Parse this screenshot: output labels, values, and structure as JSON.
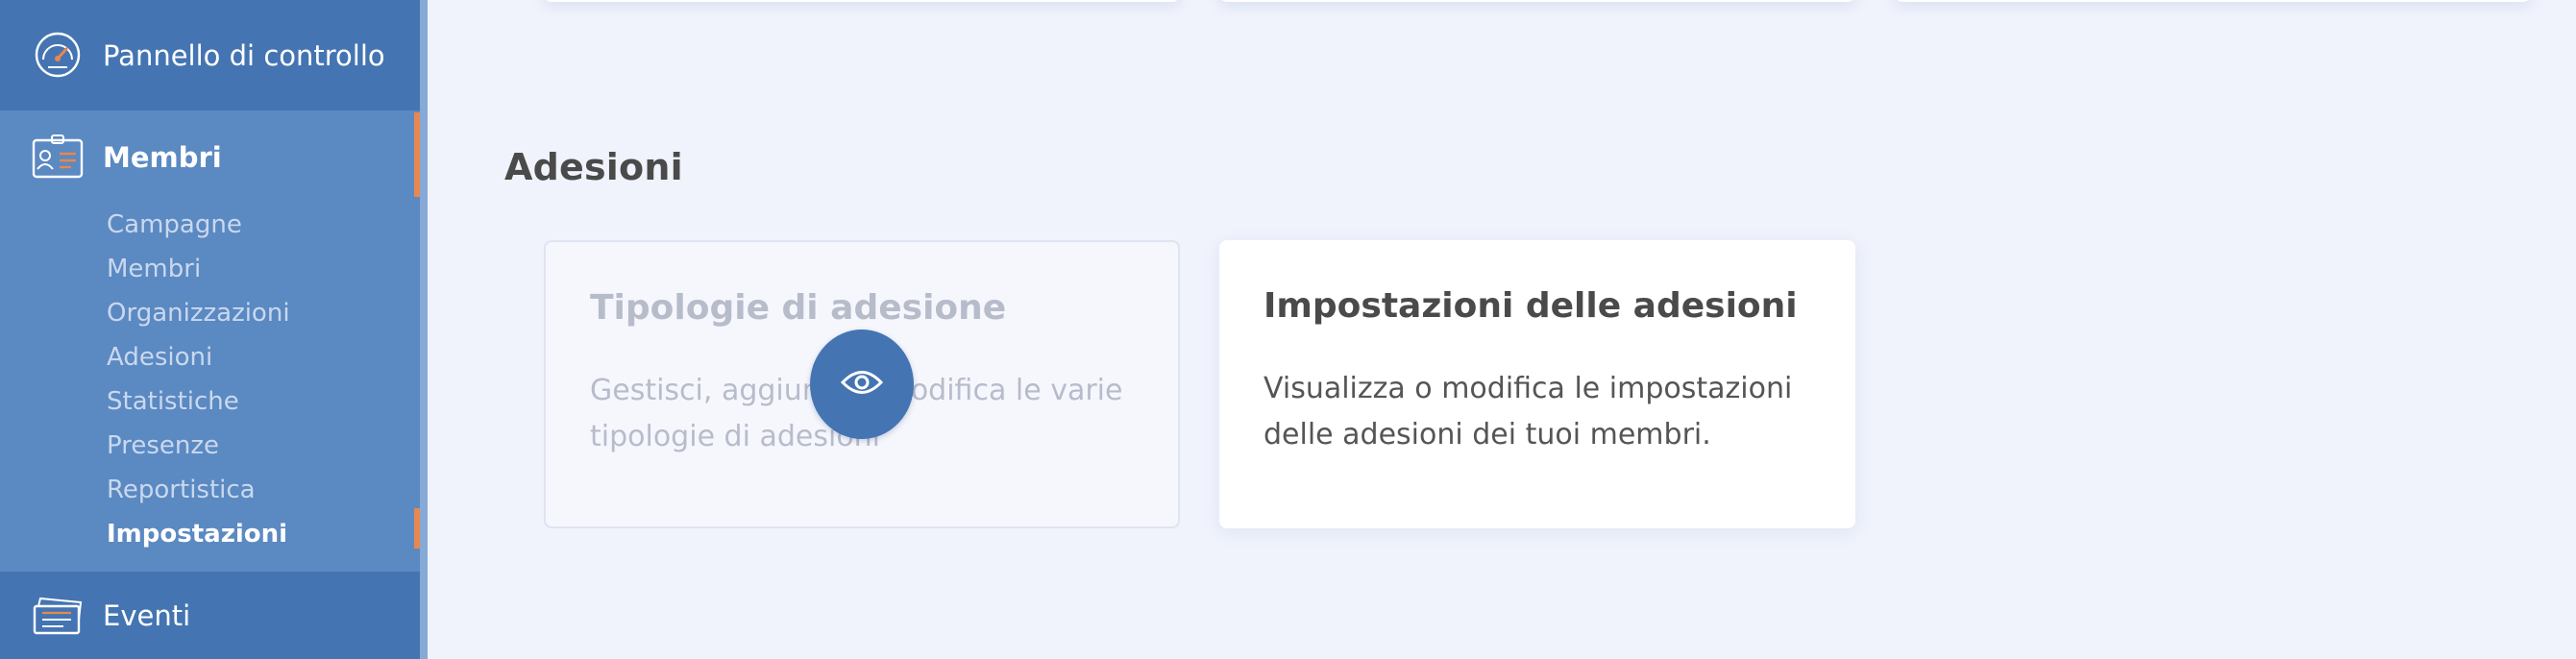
{
  "sidebar": {
    "dashboard_label": "Pannello di controllo",
    "members_label": "Membri",
    "events_label": "Eventi",
    "sub_items": [
      {
        "label": "Campagne"
      },
      {
        "label": "Membri"
      },
      {
        "label": "Organizzazioni"
      },
      {
        "label": "Adesioni"
      },
      {
        "label": "Statistiche"
      },
      {
        "label": "Presenze"
      },
      {
        "label": "Reportistica"
      },
      {
        "label": "Impostazioni",
        "active": true
      }
    ],
    "icons": {
      "dashboard": "speedometer-icon",
      "members": "id-card-icon",
      "events": "tickets-icon"
    }
  },
  "main": {
    "section_title": "Adesioni",
    "cards": [
      {
        "title": "Tipologie di adesione",
        "description": "Gestisci, aggiungi o modifica le varie tipologie di adesioni",
        "state": "hovered"
      },
      {
        "title": "Impostazioni delle adesioni",
        "description": "Visualizza o modifica le impostazioni delle adesioni dei tuoi membri."
      }
    ],
    "hover_action_icon": "eye-icon"
  },
  "colors": {
    "sidebar": "#4e7eb9",
    "sidebar_dark": "#4475b2",
    "accent": "#e8874f",
    "background": "#f0f3fc"
  }
}
